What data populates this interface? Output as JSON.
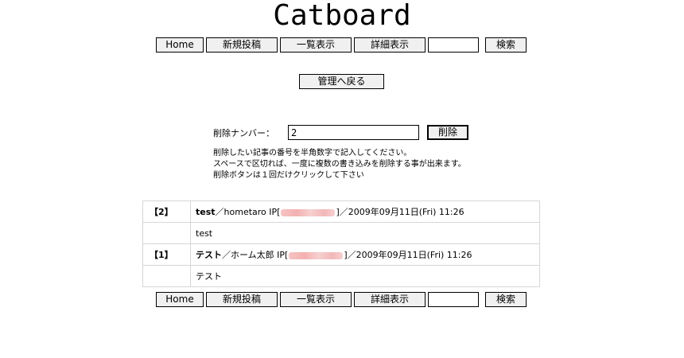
{
  "header": {
    "title": "Catboard"
  },
  "nav_top": {
    "home": "Home",
    "new_post": "新規投稿",
    "list_view": "一覧表示",
    "detail_view": "詳細表示",
    "search_value": "",
    "search": "検索"
  },
  "admin": {
    "back_label": "管理へ戻る"
  },
  "delete_form": {
    "label": "削除ナンバー：",
    "value": "2",
    "button": "削除",
    "notes": [
      "削除したい記事の番号を半角数字で記入してください。",
      "スペースで区切れば、一度に複数の書き込みを削除する事が出来ます。",
      "削除ボタンは１回だけクリックして下さい"
    ]
  },
  "posts": [
    {
      "number": "【2】",
      "subject": "test",
      "author_prefix": "／hometaro IP[",
      "suffix": "]／2009年09月11日(Fri) 11:26",
      "body": "test"
    },
    {
      "number": "【1】",
      "subject": "テスト",
      "author_prefix": "／ホーム太郎 IP[",
      "suffix": "]／2009年09月11日(Fri) 11:26",
      "body": "テスト"
    }
  ],
  "nav_bottom": {
    "home": "Home",
    "new_post": "新規投稿",
    "list_view": "一覧表示",
    "detail_view": "詳細表示",
    "search_value": "",
    "search": "検索"
  }
}
